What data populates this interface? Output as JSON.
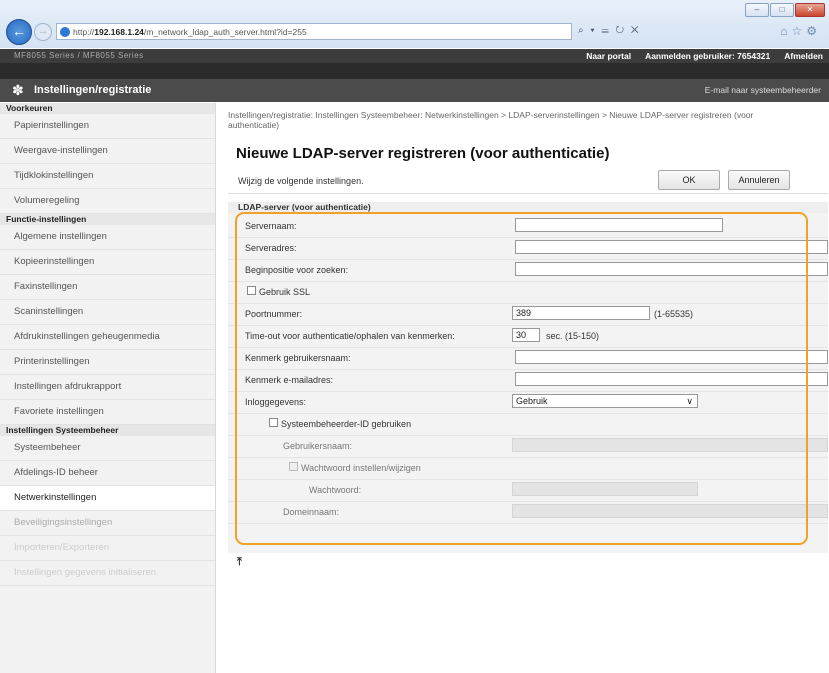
{
  "browser": {
    "url_prefix": "http://",
    "url_host": "192.168.1.24",
    "url_path": "/m_network_ldap_auth_server.html?id=255",
    "search_tools": "⌕ ▾ ☰ ↻ ✕",
    "window_buttons": {
      "minimize": "–",
      "maximize": "□",
      "close": "✕"
    }
  },
  "topbar": {
    "product": "MF8055 Series / MF8055 Series",
    "portal": "Naar portal",
    "user_label": "Aanmelden gebruiker: 7654321",
    "logout": "Afmelden"
  },
  "header": {
    "title": "Instellingen/registratie",
    "mail_admin": "E-mail naar systeembeheerder"
  },
  "sidebar": {
    "sections": [
      {
        "heading": "Voorkeuren",
        "items": [
          "Papierinstellingen",
          "Weergave-instellingen",
          "Tijdklokinstellingen",
          "Volumeregeling"
        ]
      },
      {
        "heading": "Functie-instellingen",
        "items": [
          "Algemene instellingen",
          "Kopieerinstellingen",
          "Faxinstellingen",
          "Scaninstellingen",
          "Afdrukinstellingen geheugenmedia",
          "Printerinstellingen",
          "Instellingen afdrukrapport",
          "Favoriete instellingen"
        ]
      },
      {
        "heading": "Instellingen Systeembeheer",
        "items": [
          "Systeembeheer",
          "Afdelings-ID beheer",
          "Netwerkinstellingen",
          "Beveiligingsinstellingen",
          "Importeren/Exporteren",
          "Instellingen gegevens initialiseren"
        ]
      }
    ]
  },
  "main": {
    "breadcrumb": "Instellingen/registratie: Instellingen Systeembeheer: Netwerkinstellingen > LDAP-serverinstellingen > Nieuwe LDAP-server registreren (voor authenticatie)",
    "title": "Nieuwe LDAP-server registreren (voor authenticatie)",
    "hint": "Wijzig de volgende instellingen.",
    "ok_label": "OK",
    "cancel_label": "Annuleren",
    "section_title": "LDAP-server (voor authenticatie)",
    "fields": {
      "server_name_label": "Servernaam:",
      "server_name_value": "",
      "server_address_label": "Serveradres:",
      "server_address_value": "",
      "search_start_label": "Beginpositie voor zoeken:",
      "search_start_value": "",
      "use_ssl_label": "Gebruik SSL",
      "port_label": "Poortnummer:",
      "port_value": "389",
      "port_range": "(1-65535)",
      "timeout_label": "Time-out voor authenticatie/ophalen van kenmerken:",
      "timeout_value": "30",
      "timeout_range": "sec. (15-150)",
      "username_attr_label": "Kenmerk gebruikersnaam:",
      "username_attr_value": "",
      "email_attr_label": "Kenmerk e-mailadres:",
      "email_attr_value": "",
      "login_info_label": "Inloggegevens:",
      "login_info_value": "Gebruik",
      "use_admin_id_label": "Systeembeheerder-ID gebruiken",
      "username_label": "Gebruikersnaam:",
      "set_password_label": "Wachtwoord instellen/wijzigen",
      "password_label": "Wachtwoord:",
      "domain_label": "Domeinnaam:"
    },
    "back_to_top": "⤒"
  }
}
